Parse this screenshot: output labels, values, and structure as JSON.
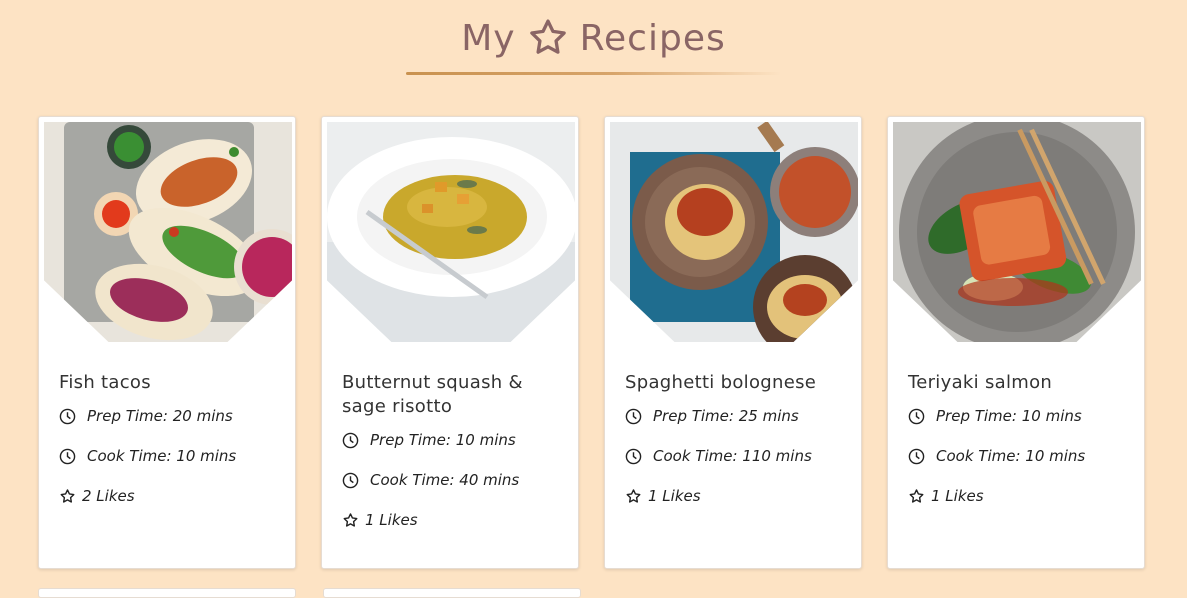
{
  "header": {
    "title_before": "My",
    "title_after": "Recipes",
    "icon": "star-icon",
    "color": "#8a6565"
  },
  "recipes": [
    {
      "title": "Fish tacos",
      "prep": "Prep Time: 20 mins",
      "cook": "Cook Time: 10 mins",
      "likes": "2 Likes"
    },
    {
      "title": "Butternut squash & sage risotto",
      "prep": "Prep Time: 10 mins",
      "cook": "Cook Time: 40 mins",
      "likes": "1 Likes"
    },
    {
      "title": "Spaghetti bolognese",
      "prep": "Prep Time: 25 mins",
      "cook": "Cook Time: 110 mins",
      "likes": "1 Likes"
    },
    {
      "title": "Teriyaki salmon",
      "prep": "Prep Time: 10 mins",
      "cook": "Cook Time: 10 mins",
      "likes": "1 Likes"
    }
  ],
  "colors": {
    "background": "#fde3c4",
    "accent": "#c9924f",
    "card": "#ffffff"
  }
}
